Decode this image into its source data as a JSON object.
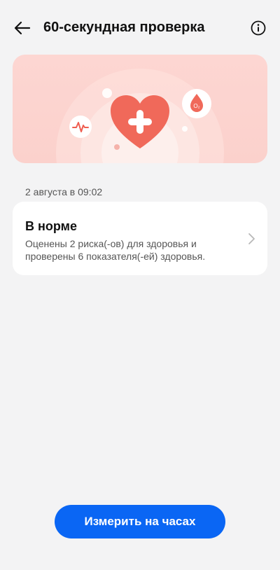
{
  "header": {
    "title": "60-секундная проверка",
    "back_icon": "arrow-left-icon",
    "info_icon": "info-circle-icon"
  },
  "banner": {
    "icons": [
      "heart-plus-icon",
      "heartbeat-icon",
      "blood-oxygen-icon"
    ],
    "heart_text": "O₂"
  },
  "result": {
    "date": "2 августа в 09:02",
    "status": "В норме",
    "description": "Оценены 2 риска(-ов) для здоровья и проверены 6 показателя(-ей) здоровья."
  },
  "actions": {
    "measure_label": "Измерить на часах"
  },
  "colors": {
    "accent": "#0a66f4",
    "banner_bg": "#fdd6d2",
    "heart": "#f0695a"
  }
}
